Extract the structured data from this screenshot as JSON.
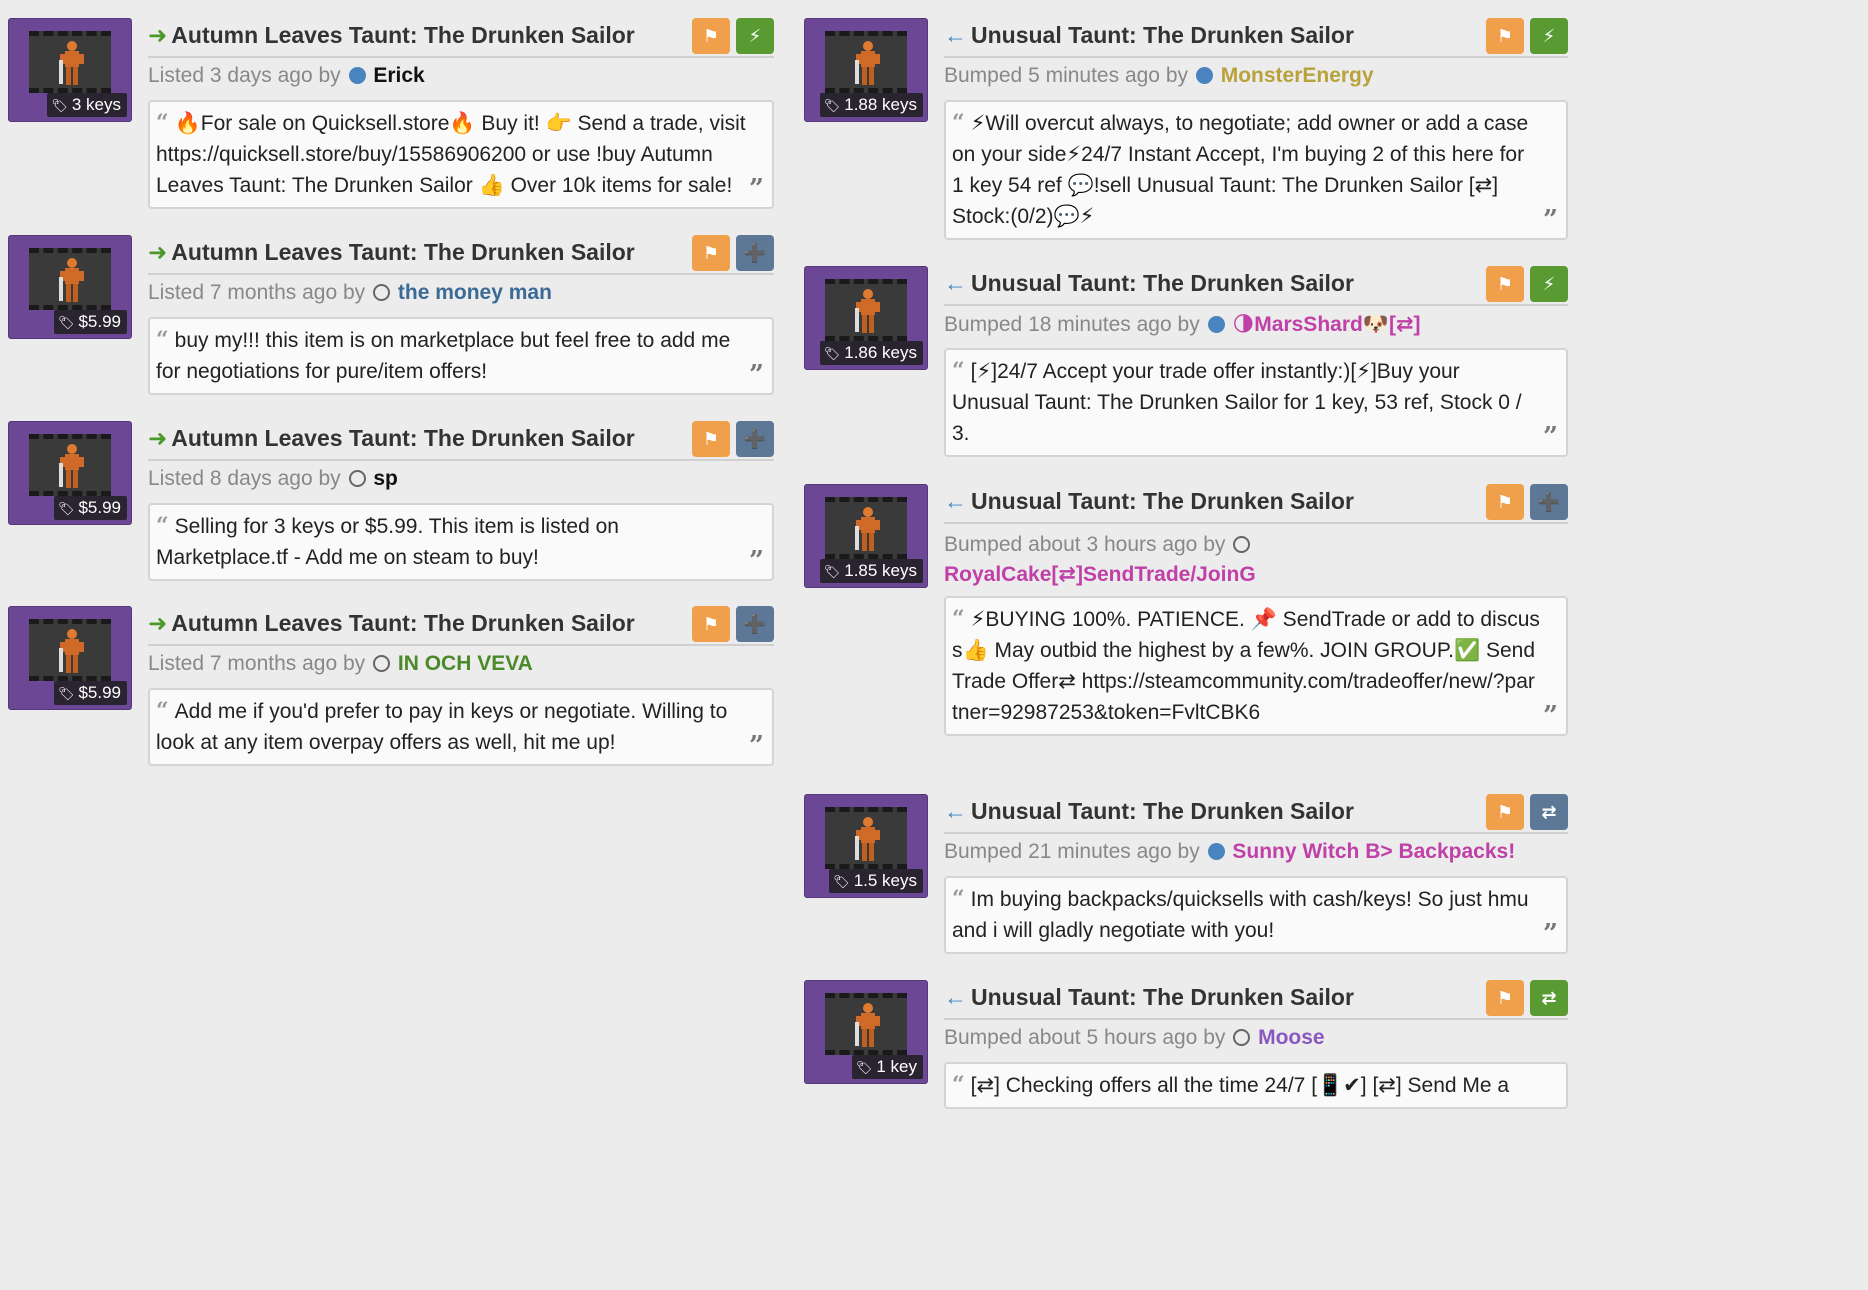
{
  "left_listings": [
    {
      "title": "Autumn Leaves Taunt: The Drunken Sailor",
      "price": "3 keys",
      "status_prefix": "Listed",
      "time": "3 days ago",
      "by": "by",
      "user": "Erick",
      "user_color": "#111111",
      "online": true,
      "buttons": [
        "flag",
        "bolt"
      ],
      "desc": "🔥For sale on Quicksell.store🔥 Buy it! 👉 Send a trade, visit https://quicksell.store/buy/15586906200 or use !buy Autumn Leaves Taunt: The Drunken Sailor 👍 Over 10k items for sale!"
    },
    {
      "title": "Autumn Leaves Taunt: The Drunken Sailor",
      "price": "$5.99",
      "status_prefix": "Listed",
      "time": "7 months ago",
      "by": "by",
      "user": "the money man",
      "user_color": "#3b6a94",
      "online": false,
      "buttons": [
        "flag",
        "addf"
      ],
      "desc": "buy my!!! this item is on marketplace but feel free to add me for negotiations for pure/item offers!"
    },
    {
      "title": "Autumn Leaves Taunt: The Drunken Sailor",
      "price": "$5.99",
      "status_prefix": "Listed",
      "time": "8 days ago",
      "by": "by",
      "user": "sp",
      "user_color": "#111111",
      "online": false,
      "buttons": [
        "flag",
        "addf"
      ],
      "desc": "Selling for 3 keys or $5.99. This item is listed on Marketplace.tf - Add me on steam to buy!"
    },
    {
      "title": "Autumn Leaves Taunt: The Drunken Sailor",
      "price": "$5.99",
      "status_prefix": "Listed",
      "time": "7 months ago",
      "by": "by",
      "user": "IN OCH VEVA",
      "user_color": "#4a8a2a",
      "online": false,
      "buttons": [
        "flag",
        "addf"
      ],
      "desc": "Add me if you'd prefer to pay in keys or negotiate. Willing to look at any item overpay offers as well, hit me up!"
    }
  ],
  "right_listings": [
    {
      "title": "Unusual Taunt: The Drunken Sailor",
      "price": "1.88 keys",
      "status_prefix": "Bumped",
      "time": "5 minutes ago",
      "by": "by",
      "user": "MonsterEnergy",
      "user_color": "#b8a23a",
      "online": true,
      "buttons": [
        "flag",
        "bolt"
      ],
      "desc": "⚡Will overcut always, to negotiate; add owner or add a case on your side⚡24/7 Instant Accept, I'm buying 2 of this here for 1 key 54 ref 💬!sell Unusual Taunt: The Drunken Sailor [⇄] Stock:(0/2)💬⚡"
    },
    {
      "title": "Unusual Taunt: The Drunken Sailor",
      "price": "1.86 keys",
      "status_prefix": "Bumped",
      "time": "18 minutes ago",
      "by": "by",
      "user": "🌗MarsShard🐶[⇄]",
      "user_color": "#c040a8",
      "online": true,
      "buttons": [
        "flag",
        "bolt"
      ],
      "desc": "[⚡]24/7 Accept your trade offer instantly:)[⚡]Buy your Unusual Taunt: The Drunken Sailor for 1 key, 53 ref, Stock 0 / 3."
    },
    {
      "title": "Unusual Taunt: The Drunken Sailor",
      "price": "1.85 keys",
      "status_prefix": "Bumped",
      "time": "about 3 hours ago",
      "by": "by",
      "user": "RoyalCake[⇄]SendTrade/JoinG",
      "user_color": "#c040a8",
      "online": false,
      "buttons": [
        "flag",
        "addf"
      ],
      "desc": "⚡BUYING 100%. PATIENCE. 📌 SendTrade or add to discuss👍 May outbid the highest by a few%. JOIN GROUP.✅ Send Trade Offer⇄ https://steamcommunity.com/tradeoffer/new/?partner=92987253&token=FvltCBK6"
    },
    {
      "title": "Unusual Taunt: The Drunken Sailor",
      "price": "1.5 keys",
      "status_prefix": "Bumped",
      "time": "21 minutes ago",
      "by": "by",
      "user": "Sunny Witch B> Backpacks!",
      "user_color": "#c040a8",
      "online": true,
      "buttons": [
        "flag",
        "trade"
      ],
      "desc": "Im buying backpacks/quicksells with cash/keys! So just hmu and i will gladly negotiate with you!"
    },
    {
      "title": "Unusual Taunt: The Drunken Sailor",
      "price": "1 key",
      "status_prefix": "Bumped",
      "time": "about 5 hours ago",
      "by": "by",
      "user": "Moose",
      "user_color": "#8a58c0",
      "online": false,
      "buttons": [
        "flag",
        "trade-green"
      ],
      "desc": "[⇄] Checking offers all the time 24/7 [📱✔] [⇄] Send Me a"
    }
  ],
  "icons": {
    "sell_arrow": "arrow-right-icon",
    "buy_arrow": "arrow-left-icon",
    "flag": "flag-icon",
    "bolt": "bolt-icon",
    "add_friend": "add-friend-icon",
    "trade": "trade-icon",
    "price_tag": "price-tag-icon"
  },
  "colors": {
    "thumb_bg": "#6b4795",
    "flag_btn": "#f0a04a",
    "bolt_btn": "#5a9a32",
    "addf_btn": "#5c7896",
    "sell_arrow": "#4a9a2a",
    "buy_arrow": "#3c86c4"
  }
}
